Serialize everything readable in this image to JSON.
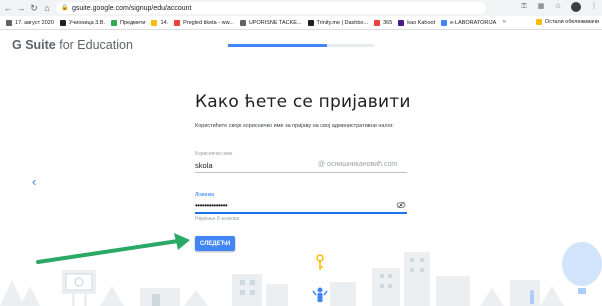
{
  "browser": {
    "url": "gsuite.google.com/signup/edu/account",
    "bookmarks": [
      {
        "label": "17. август 2020",
        "color": "#5f6368"
      },
      {
        "label": "Учионица 3.В.",
        "color": "#202124"
      },
      {
        "label": "Предмети",
        "color": "#34a853"
      },
      {
        "label": "14.",
        "color": "#fbbc04"
      },
      {
        "label": "Pregled tiketa - ww...",
        "color": "#ea4335"
      },
      {
        "label": "UPORISNE TACKE...",
        "color": "#5f6368"
      },
      {
        "label": "Trinity.me | Dashbo...",
        "color": "#202124"
      },
      {
        "label": "365",
        "color": "#ea4335"
      },
      {
        "label": "kao Kahoot",
        "color": "#46178f"
      },
      {
        "label": "e-LABORATORIJA",
        "color": "#4285f4"
      }
    ],
    "bookmarks_more": "»",
    "other_bookmarks": "Остали обележивачи"
  },
  "header": {
    "logo_prefix": "G Suite",
    "logo_suffix": " for Education",
    "progress": 0.68
  },
  "form": {
    "title": "Како ћете се пријавити",
    "description": "Користићете своје корисничко име за пријаву на свој административни налог.",
    "username_label": "Корисничко име",
    "username_value": "skola",
    "domain_suffix": "@ оснишникановић.com",
    "password_label": "Лозинка",
    "password_value": "••••••••••••••",
    "password_hint": "Најмање 8 знакова",
    "next_button": "СЛЕДЕЋИ"
  },
  "colors": {
    "accent": "#4285f4",
    "arrow": "#2aa866"
  }
}
